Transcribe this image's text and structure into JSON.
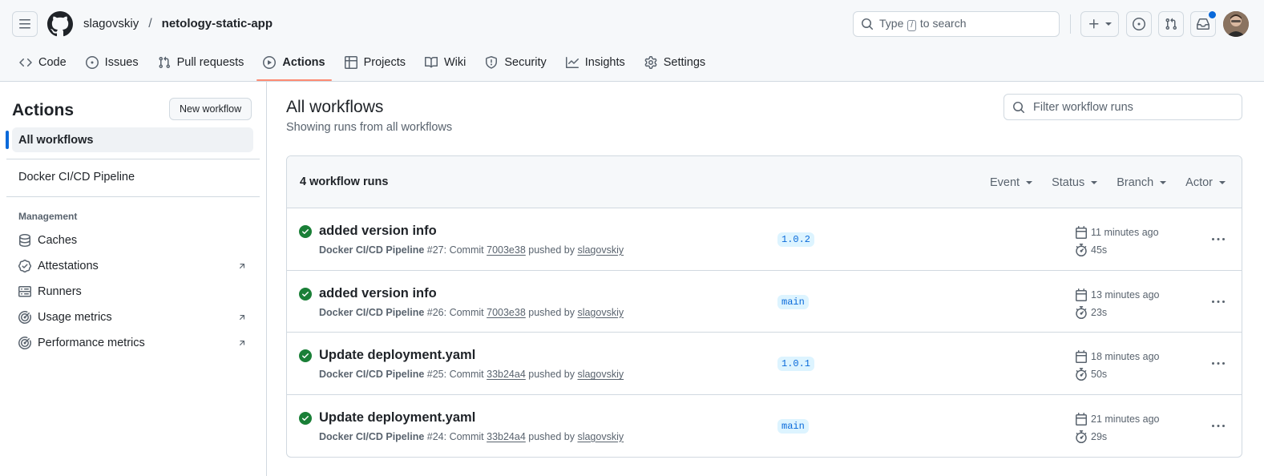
{
  "header": {
    "owner": "slagovskiy",
    "separator": "/",
    "repo": "netology-static-app",
    "search_prefix": "Type",
    "search_key": "/",
    "search_suffix": "to search",
    "accent": "#0969da"
  },
  "repo_nav": {
    "code": "Code",
    "issues": "Issues",
    "pull_requests": "Pull requests",
    "actions": "Actions",
    "projects": "Projects",
    "wiki": "Wiki",
    "security": "Security",
    "insights": "Insights",
    "settings": "Settings"
  },
  "sidebar": {
    "title": "Actions",
    "new_workflow": "New workflow",
    "all_workflows": "All workflows",
    "workflow": "Docker CI/CD Pipeline",
    "management_heading": "Management",
    "management": [
      {
        "label": "Caches",
        "icon": "database-icon"
      },
      {
        "label": "Attestations",
        "icon": "verified-icon"
      },
      {
        "label": "Runners",
        "icon": "server-icon"
      },
      {
        "label": "Usage metrics",
        "icon": "meter-icon"
      },
      {
        "label": "Performance metrics",
        "icon": "meter-icon"
      }
    ]
  },
  "main": {
    "title": "All workflows",
    "subtitle": "Showing runs from all workflows",
    "filter_placeholder": "Filter workflow runs",
    "runs_count": "4 workflow runs",
    "filters": {
      "event": "Event",
      "status": "Status",
      "branch": "Branch",
      "actor": "Actor"
    },
    "runs": [
      {
        "title": "added version info",
        "workflow": "Docker CI/CD Pipeline",
        "run": "#27: Commit",
        "commit": "7003e38",
        "pushed_by": "pushed by",
        "actor": "slagovskiy",
        "branch": "1.0.2",
        "when": "11 minutes ago",
        "duration": "45s",
        "status": "success"
      },
      {
        "title": "added version info",
        "workflow": "Docker CI/CD Pipeline",
        "run": "#26: Commit",
        "commit": "7003e38",
        "pushed_by": "pushed by",
        "actor": "slagovskiy",
        "branch": "main",
        "when": "13 minutes ago",
        "duration": "23s",
        "status": "success"
      },
      {
        "title": "Update deployment.yaml",
        "workflow": "Docker CI/CD Pipeline",
        "run": "#25: Commit",
        "commit": "33b24a4",
        "pushed_by": "pushed by",
        "actor": "slagovskiy",
        "branch": "1.0.1",
        "when": "18 minutes ago",
        "duration": "50s",
        "status": "success"
      },
      {
        "title": "Update deployment.yaml",
        "workflow": "Docker CI/CD Pipeline",
        "run": "#24: Commit",
        "commit": "33b24a4",
        "pushed_by": "pushed by",
        "actor": "slagovskiy",
        "branch": "main",
        "when": "21 minutes ago",
        "duration": "29s",
        "status": "success"
      }
    ]
  },
  "colors": {
    "success": "#1a7f37",
    "active_tab_underline": "#fd8c73",
    "branch_bg": "#ddf4ff"
  }
}
